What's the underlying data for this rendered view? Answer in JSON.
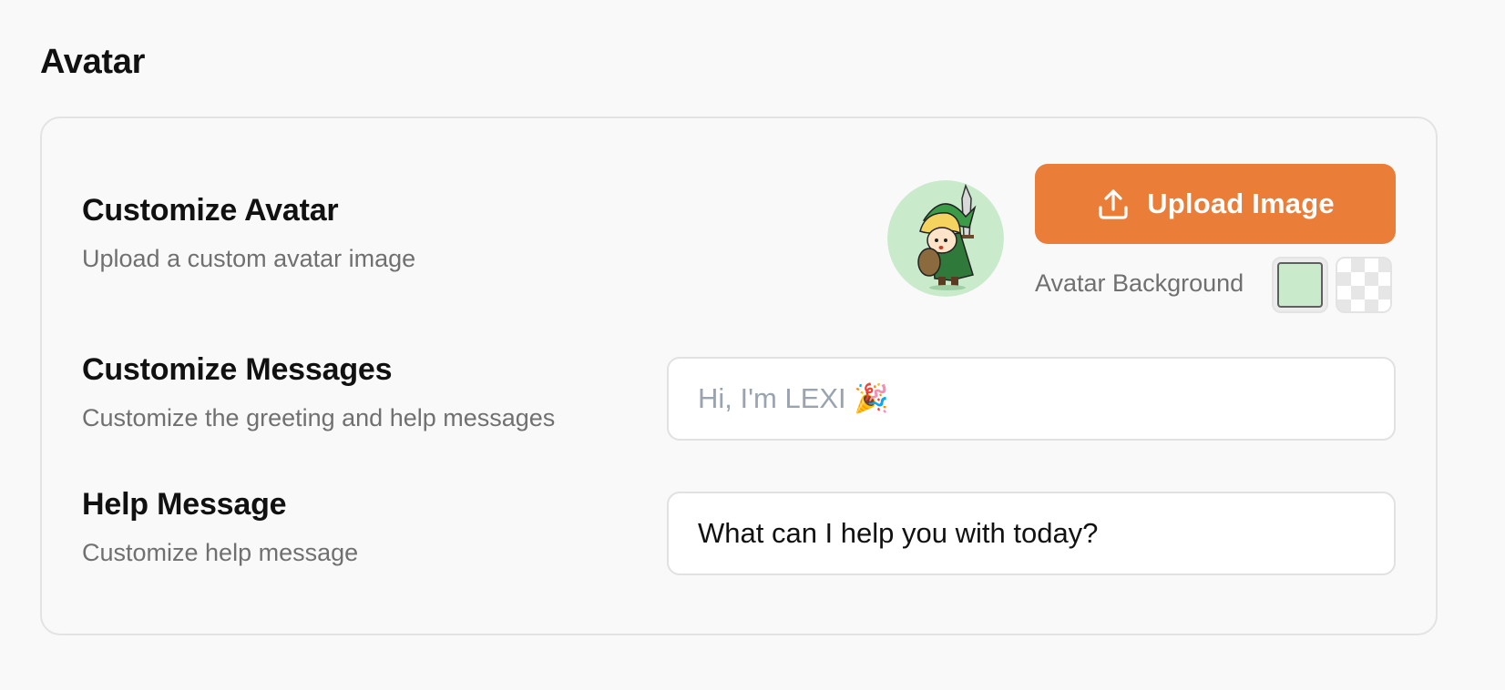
{
  "section": {
    "title": "Avatar"
  },
  "avatar_row": {
    "title": "Customize Avatar",
    "subtitle": "Upload a custom avatar image",
    "avatar_icon": "avatar-character-image",
    "avatar_background_color": "#c9ebcc",
    "upload_button_label": "Upload Image",
    "upload_icon": "upload-icon",
    "background_label": "Avatar Background",
    "swatches": [
      {
        "name": "green",
        "color": "#c9ebcc",
        "selected": true
      },
      {
        "name": "transparent",
        "color": "transparent",
        "selected": false
      }
    ]
  },
  "messages_row": {
    "title": "Customize Messages",
    "subtitle": "Customize the greeting and help messages",
    "greeting_placeholder": "Hi, I'm LEXI 🎉",
    "greeting_value": ""
  },
  "help_row": {
    "title": "Help Message",
    "subtitle": "Customize help message",
    "help_value": "What can I help you with today?"
  },
  "colors": {
    "accent": "#ea7d37",
    "muted_text": "#707070",
    "border": "#e3e3e3",
    "background": "#f9f9f9"
  }
}
